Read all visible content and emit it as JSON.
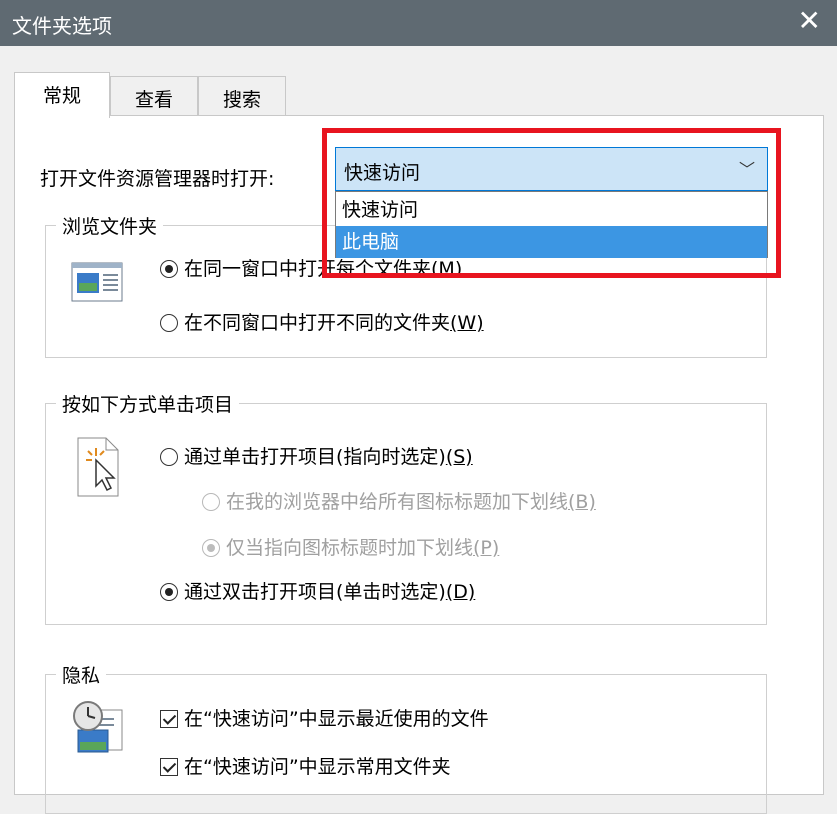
{
  "window": {
    "title": "文件夹选项",
    "close_glyph": "✕"
  },
  "tabs": [
    {
      "label": "常规",
      "active": true
    },
    {
      "label": "查看",
      "active": false
    },
    {
      "label": "搜索",
      "active": false
    }
  ],
  "open_in": {
    "label": "打开文件资源管理器时打开:",
    "selected": "快速访问",
    "chevron": "﹀",
    "options": [
      "快速访问",
      "此电脑"
    ],
    "hovered_option": "此电脑"
  },
  "browse_folders": {
    "legend": "浏览文件夹",
    "option_same_window": {
      "text": "在同一窗口中打开每个文件夹",
      "key": "(M)",
      "checked": true
    },
    "option_new_window": {
      "text": "在不同窗口中打开不同的文件夹",
      "key": "(W)",
      "checked": false
    }
  },
  "click_items": {
    "legend": "按如下方式单击项目",
    "single_click": {
      "text": "通过单击打开项目(指向时选定)",
      "key": "(S)",
      "checked": false
    },
    "underline_always": {
      "text": "在我的浏览器中给所有图标标题加下划线",
      "key": "(B)",
      "checked": false
    },
    "underline_hover": {
      "text": "仅当指向图标标题时加下划线",
      "key": "(P)",
      "checked": true
    },
    "double_click": {
      "text": "通过双击打开项目(单击时选定)",
      "key": "(D)",
      "checked": true
    }
  },
  "privacy": {
    "legend": "隐私",
    "recent_files": {
      "text": "在“快速访问”中显示最近使用的文件",
      "checked": true
    },
    "frequent_folders": {
      "text": "在“快速访问”中显示常用文件夹",
      "checked": true
    }
  },
  "colors": {
    "accent": "#0078d7",
    "highlight_border": "#e8141f",
    "titlebar": "#5f6a72",
    "hover": "#3c96e3"
  }
}
